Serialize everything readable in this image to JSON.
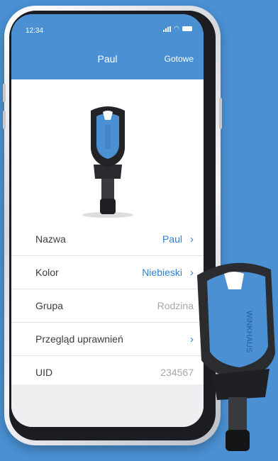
{
  "status": {
    "time": "12:34"
  },
  "header": {
    "title": "Paul",
    "done_label": "Gotowe"
  },
  "key": {
    "brand": "WINKHAUS",
    "color": "#4a90d3"
  },
  "rows": [
    {
      "label": "Nazwa",
      "value": "Paul"
    },
    {
      "label": "Kolor",
      "value": "Niebieski"
    },
    {
      "label": "Grupa",
      "value": "Rodzina"
    },
    {
      "label": "Przegląd uprawnień",
      "value": ""
    },
    {
      "label": "UID",
      "value": "234567"
    }
  ]
}
